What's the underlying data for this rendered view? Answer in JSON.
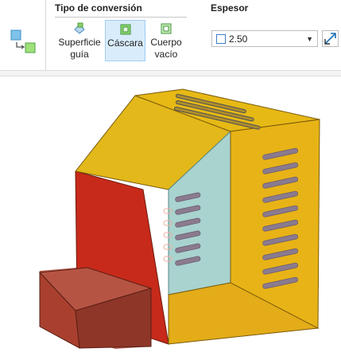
{
  "ribbon": {
    "conversion_group": {
      "title": "Tipo de conversión",
      "buttons": [
        {
          "line1": "Superficie",
          "line2": "guía",
          "icon": "surface-icon",
          "active": false
        },
        {
          "line1": "Cáscara",
          "line2": "",
          "icon": "shell-icon",
          "active": true
        },
        {
          "line1": "Cuerpo",
          "line2": "vacío",
          "icon": "hollow-body-icon",
          "active": false
        }
      ]
    },
    "thickness_group": {
      "title": "Espesor",
      "value": "2.50",
      "flip_icon": "flip-direction-icon"
    },
    "left_icon": "convert-body-icon"
  },
  "viewport": {
    "colors": {
      "top": "#e3b81a",
      "side": "#e8b316",
      "red_face": "#c72a1a",
      "inner_panel": "#a8d3cf",
      "box": "#b34a38",
      "slots": "#8a7b8e"
    }
  }
}
